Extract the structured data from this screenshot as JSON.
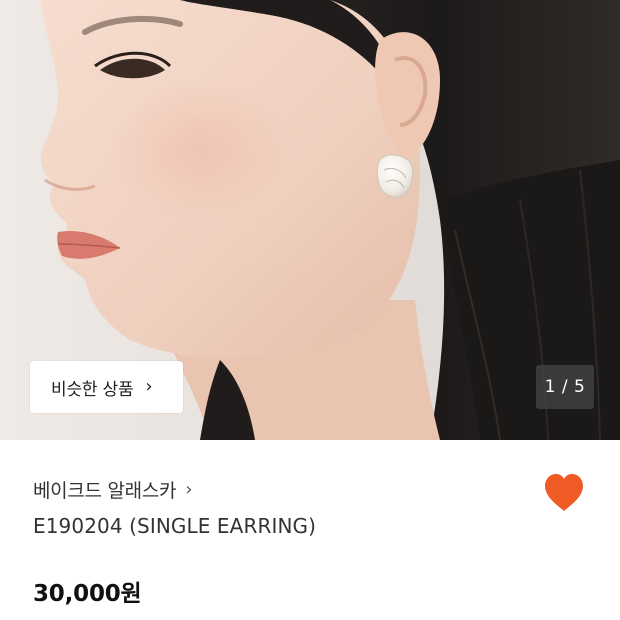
{
  "hero": {
    "image_label": "model-wearing-earring-photo",
    "similar_button_label": "비슷한 상품",
    "chevron": "›",
    "counter": "1 / 5"
  },
  "product": {
    "brand": "베이크드 알래스카",
    "brand_chevron": "›",
    "name": "E190204 (SINGLE EARRING)",
    "price": "30,000원",
    "wishlist_icon": "heart-icon",
    "accent_color": "#F05A24"
  }
}
